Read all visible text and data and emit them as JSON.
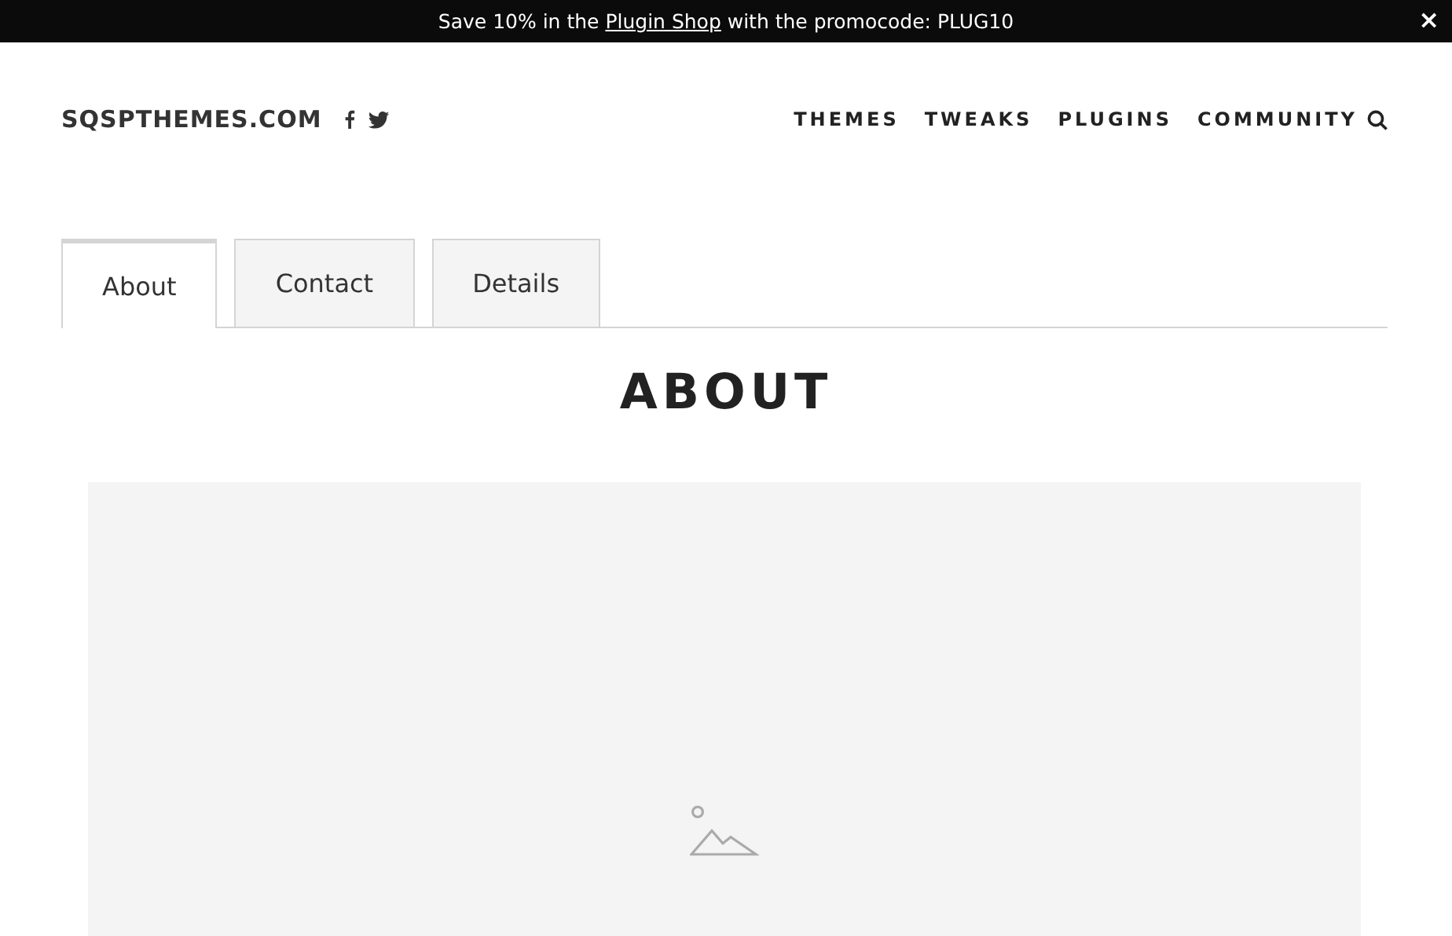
{
  "banner": {
    "prefix": "Save 10% in the ",
    "link": "Plugin Shop",
    "suffix": " with the promocode: PLUG10",
    "close": "×"
  },
  "header": {
    "logo": "SQSPTHEMES.COM",
    "nav": [
      "THEMES",
      "TWEAKS",
      "PLUGINS",
      "COMMUNITY"
    ]
  },
  "tabs": [
    {
      "label": "About",
      "selected": true
    },
    {
      "label": "Contact",
      "selected": false
    },
    {
      "label": "Details",
      "selected": false
    }
  ],
  "heading": "ABOUT",
  "image": {
    "kind": "placeholder"
  }
}
